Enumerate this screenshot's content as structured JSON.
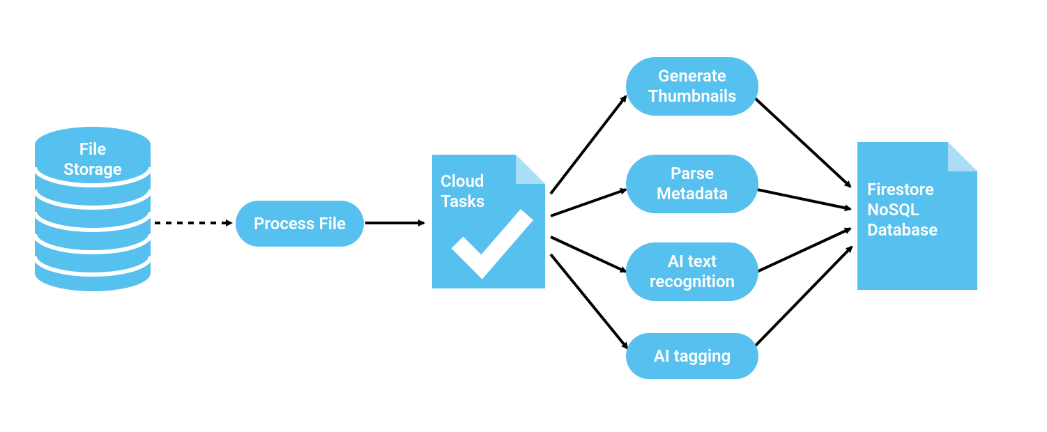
{
  "colors": {
    "node_fill": "#56c0ee",
    "node_text": "#ffffff",
    "arrow": "#000000",
    "background": "#ffffff"
  },
  "nodes": {
    "file_storage": "File\nStorage",
    "process_file": "Process File",
    "cloud_tasks": "Cloud\nTasks",
    "tasks": {
      "generate_thumbnails": "Generate\nThumbnails",
      "parse_metadata": "Parse\nMetadata",
      "ai_text_recognition": "AI  text\nrecognition",
      "ai_tagging": "AI tagging"
    },
    "firestore": "Firestore\nNoSQL\nDatabase"
  },
  "edges": [
    {
      "from": "file_storage",
      "to": "process_file",
      "style": "dashed"
    },
    {
      "from": "process_file",
      "to": "cloud_tasks",
      "style": "solid"
    },
    {
      "from": "cloud_tasks",
      "to": "generate_thumbnails",
      "style": "solid"
    },
    {
      "from": "cloud_tasks",
      "to": "parse_metadata",
      "style": "solid"
    },
    {
      "from": "cloud_tasks",
      "to": "ai_text_recognition",
      "style": "solid"
    },
    {
      "from": "cloud_tasks",
      "to": "ai_tagging",
      "style": "solid"
    },
    {
      "from": "generate_thumbnails",
      "to": "firestore",
      "style": "solid"
    },
    {
      "from": "parse_metadata",
      "to": "firestore",
      "style": "solid"
    },
    {
      "from": "ai_text_recognition",
      "to": "firestore",
      "style": "solid"
    },
    {
      "from": "ai_tagging",
      "to": "firestore",
      "style": "solid"
    }
  ]
}
